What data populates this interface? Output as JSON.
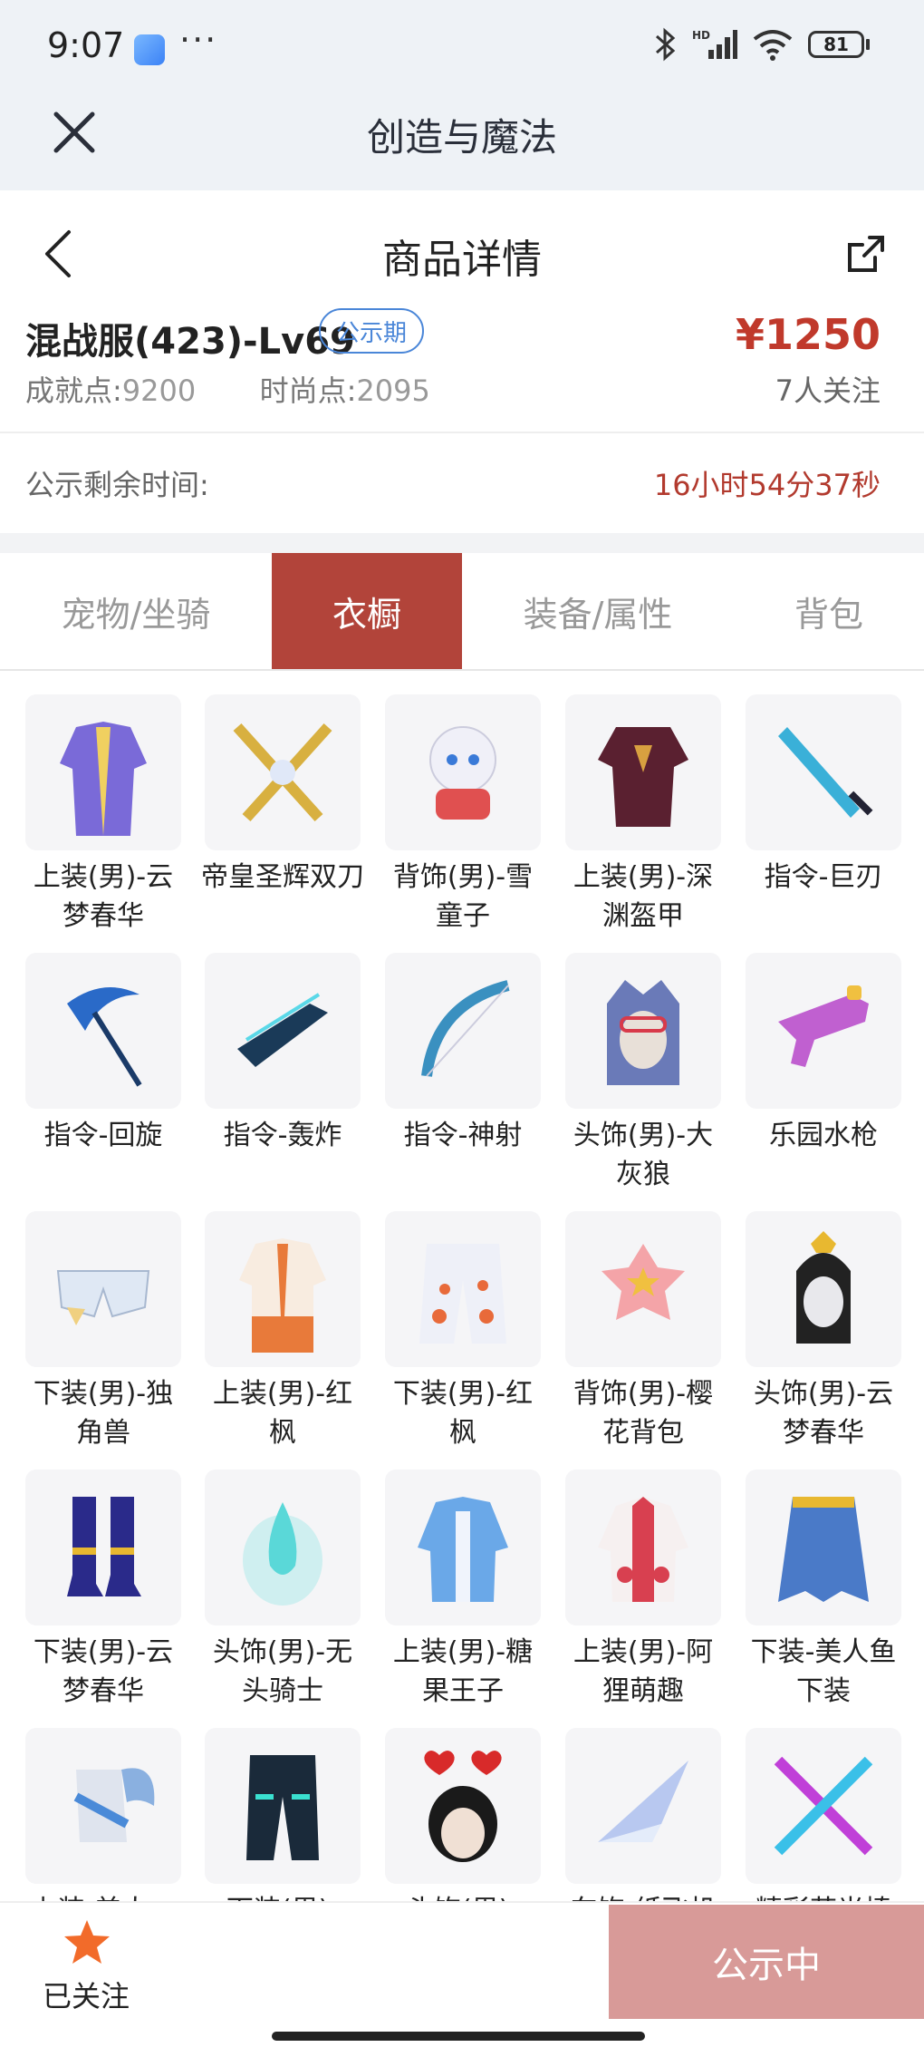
{
  "status_bar": {
    "time": "9:07",
    "more": "···",
    "battery": "81"
  },
  "app_bar": {
    "title": "创造与魔法"
  },
  "nav": {
    "title": "商品详情"
  },
  "product": {
    "name": "混战服(423)-Lv69",
    "badge": "公示期",
    "achievement_label": "成就点:",
    "achievement_value": "9200",
    "fashion_label": "时尚点:",
    "fashion_value": "2095",
    "price": "¥1250",
    "followers": "7人关注"
  },
  "countdown": {
    "label": "公示剩余时间:",
    "value": "16小时54分37秒"
  },
  "tabs": [
    {
      "label": "宠物/坐骑",
      "active": false
    },
    {
      "label": "衣橱",
      "active": true
    },
    {
      "label": "装备/属性",
      "active": false
    },
    {
      "label": "背包",
      "active": false
    }
  ],
  "items": [
    {
      "label": "上装(男)-云梦春华",
      "icon": "robe-icon",
      "color": "#7a6ad8"
    },
    {
      "label": "帝皇圣辉双刀",
      "icon": "crossed-blades-icon",
      "color": "#d8b040"
    },
    {
      "label": "背饰(男)-雪童子",
      "icon": "snow-doll-icon",
      "color": "#f0f0f8"
    },
    {
      "label": "上装(男)-深渊盔甲",
      "icon": "armor-icon",
      "color": "#5a2030"
    },
    {
      "label": "指令-巨刃",
      "icon": "great-sword-icon",
      "color": "#3ab0d8"
    },
    {
      "label": "指令-回旋",
      "icon": "scythe-icon",
      "color": "#2a6ac8"
    },
    {
      "label": "指令-轰炸",
      "icon": "bomber-icon",
      "color": "#1a3a58"
    },
    {
      "label": "指令-神射",
      "icon": "bow-icon",
      "color": "#3a90c0"
    },
    {
      "label": "头饰(男)-大灰狼",
      "icon": "wolf-hood-icon",
      "color": "#6a7ab8"
    },
    {
      "label": "乐园水枪",
      "icon": "water-gun-icon",
      "color": "#c060d0"
    },
    {
      "label": "下装(男)-独角兽",
      "icon": "unicorn-pants-icon",
      "color": "#dfe8f4"
    },
    {
      "label": "上装(男)-红枫",
      "icon": "maple-robe-icon",
      "color": "#e87a3a"
    },
    {
      "label": "下装(男)-红枫",
      "icon": "maple-pants-icon",
      "color": "#e86a3a"
    },
    {
      "label": "背饰(男)-樱花背包",
      "icon": "sakura-bag-icon",
      "color": "#f4a4a8"
    },
    {
      "label": "头饰(男)-云梦春华",
      "icon": "crown-hair-icon",
      "color": "#222222"
    },
    {
      "label": "下装(男)-云梦春华",
      "icon": "boots-icon",
      "color": "#2a2a8a"
    },
    {
      "label": "头饰(男)-无头骑士",
      "icon": "ghost-flame-icon",
      "color": "#5ad8d8"
    },
    {
      "label": "上装(男)-糖果王子",
      "icon": "prince-coat-icon",
      "color": "#6aa8e8"
    },
    {
      "label": "上装(男)-阿狸萌趣",
      "icon": "hoodie-icon",
      "color": "#d84050"
    },
    {
      "label": "下装-美人鱼下装",
      "icon": "mermaid-skirt-icon",
      "color": "#4a7ac8"
    },
    {
      "label": "上装-美人…",
      "icon": "wing-top-icon",
      "color": "#8ab0e0"
    },
    {
      "label": "下装(男)-无…",
      "icon": "dark-pants-icon",
      "color": "#1a2a3a"
    },
    {
      "label": "头饰(男)-爱…",
      "icon": "heart-headband-icon",
      "color": "#d82a2a"
    },
    {
      "label": "车饰-纸飞机",
      "icon": "paper-plane-icon",
      "color": "#b8c8f0"
    },
    {
      "label": "精彩荧光棒",
      "icon": "glow-sticks-icon",
      "color": "#c040d8"
    }
  ],
  "bottom": {
    "follow_label": "已关注",
    "cta_label": "公示中"
  },
  "colors": {
    "accent": "#b2443a",
    "price": "#c0392b",
    "badge": "#4a86d8",
    "cta": "#d89a98",
    "star": "#f26b2a"
  }
}
